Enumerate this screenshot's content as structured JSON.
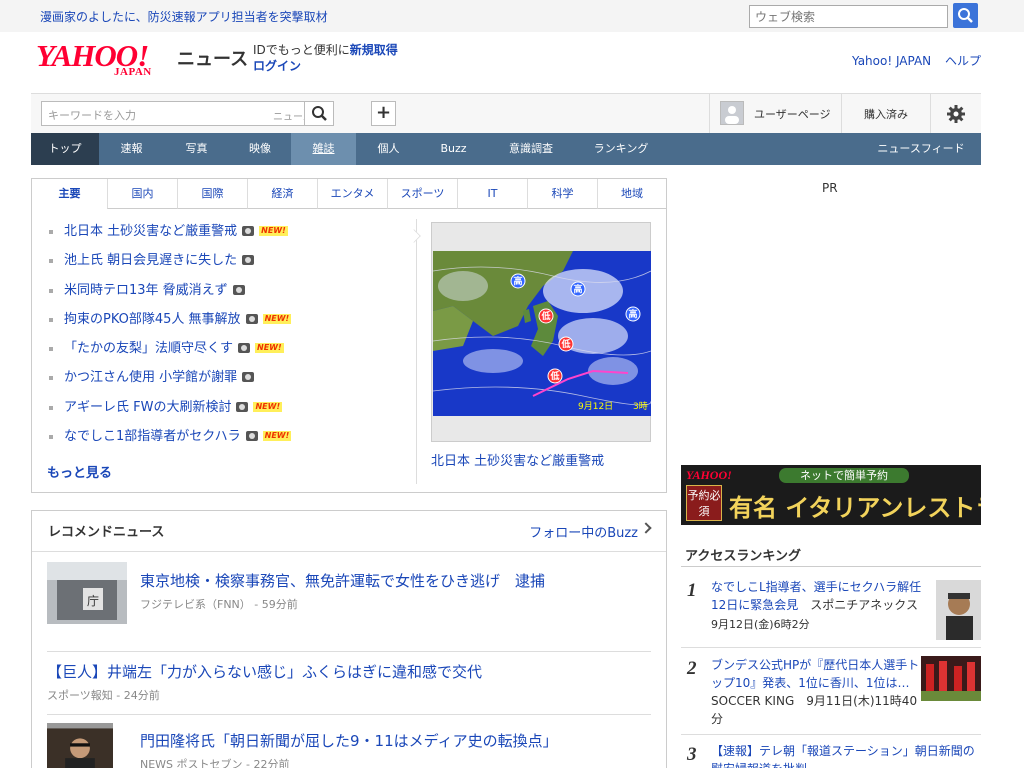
{
  "top": {
    "promo": "漫画家のよしたに、防災速報アプリ担当者を突撃取材",
    "web_search_placeholder": "ウェブ検索"
  },
  "header": {
    "logo_text": "YAHOO!",
    "logo_sub": "JAPAN",
    "service": "ニュース",
    "id_text": "IDでもっと便利に",
    "id_register": "新規取得",
    "login": "ログイン",
    "links": [
      "Yahoo! JAPAN",
      "ヘルプ"
    ]
  },
  "searchbar": {
    "placeholder": "キーワードを入力",
    "category": "ニュース",
    "plus": "+",
    "user_page": "ユーザーページ",
    "purchased": "購入済み"
  },
  "nav": {
    "items": [
      "トップ",
      "速報",
      "写真",
      "映像",
      "雑誌",
      "個人",
      "Buzz",
      "意識調査",
      "ランキング"
    ],
    "feed": "ニュースフィード"
  },
  "topics": {
    "tabs": [
      "主要",
      "国内",
      "国際",
      "経済",
      "エンタメ",
      "スポーツ",
      "IT",
      "科学",
      "地域"
    ],
    "headlines": [
      {
        "text": "北日本 土砂災害など厳重警戒",
        "camera": true,
        "new": true
      },
      {
        "text": "池上氏 朝日会見遅きに失した",
        "camera": true,
        "new": false
      },
      {
        "text": "米同時テロ13年 脅威消えず",
        "camera": true,
        "new": false
      },
      {
        "text": "拘束のPKO部隊45人 無事解放",
        "camera": true,
        "new": true
      },
      {
        "text": "「たかの友梨」法順守尽くす",
        "camera": true,
        "new": true
      },
      {
        "text": "かつ江さん使用 小学館が謝罪",
        "camera": true,
        "new": false
      },
      {
        "text": "アギーレ氏 FWの大刷新検討",
        "camera": true,
        "new": true
      },
      {
        "text": "なでしこ1部指導者がセクハラ",
        "camera": true,
        "new": true
      }
    ],
    "new_label": "NEW!",
    "more": "もっと見る",
    "pickup_caption": "北日本 土砂災害など厳重警戒",
    "map_date": "9月12日",
    "map_time": "3時",
    "map_high": "高",
    "map_low": "低"
  },
  "recommend": {
    "title": "レコメンドニュース",
    "follow": "フォロー中のBuzz",
    "items": [
      {
        "title": "東京地検・検察事務官、無免許運転で女性をひき逃げ　逮捕",
        "meta": "フジテレビ系（FNN） - 59分前"
      },
      {
        "title": "【巨人】井端左「力が入らない感じ」ふくらはぎに違和感で交代",
        "meta": "スポーツ報知 - 24分前"
      },
      {
        "title": "門田隆将氏「朝日新聞が屈した9・11はメディア史の転換点」",
        "meta": "NEWS ポストセブン - 22分前"
      }
    ]
  },
  "right": {
    "pr": "PR",
    "ad": {
      "logo": "YAHOO!",
      "top": "ネットで簡単予約",
      "tag": "予約必須",
      "big": "有名 イタリアンレストラン"
    },
    "ranking_title": "アクセスランキング",
    "ranking": [
      {
        "n": "1",
        "title": "なでしこL指導者、選手にセクハラ解任 12日に緊急会見",
        "source": "スポニチアネックス",
        "meta": "9月12日(金)6時2分"
      },
      {
        "n": "2",
        "title": "ブンデス公式HPが『歴代日本人選手トップ10』発表、1位に香川、1位は…",
        "source": "SOCCER KING",
        "meta": "9月11日(木)11時40分"
      },
      {
        "n": "3",
        "title": "【速報】テレ朝「報道ステーション」朝日新聞の慰安婦報道を批判",
        "source": "",
        "meta": ""
      }
    ]
  }
}
